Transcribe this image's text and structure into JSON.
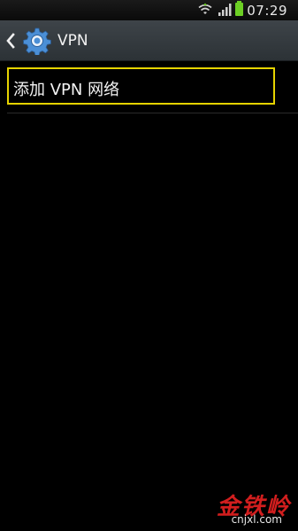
{
  "status_bar": {
    "time": "07:29",
    "icons": [
      "wifi-icon",
      "signal-icon",
      "battery-icon"
    ],
    "battery_color": "#6ccf24"
  },
  "action_bar": {
    "title": "VPN",
    "back_icon": "chevron-left-icon",
    "app_icon": "settings-gear-icon"
  },
  "list": {
    "items": [
      {
        "label": "添加 VPN 网络"
      }
    ],
    "highlight_color": "#e6d300"
  },
  "watermark": {
    "logo_text": "金铁岭",
    "domain": "cnjxl.com"
  }
}
